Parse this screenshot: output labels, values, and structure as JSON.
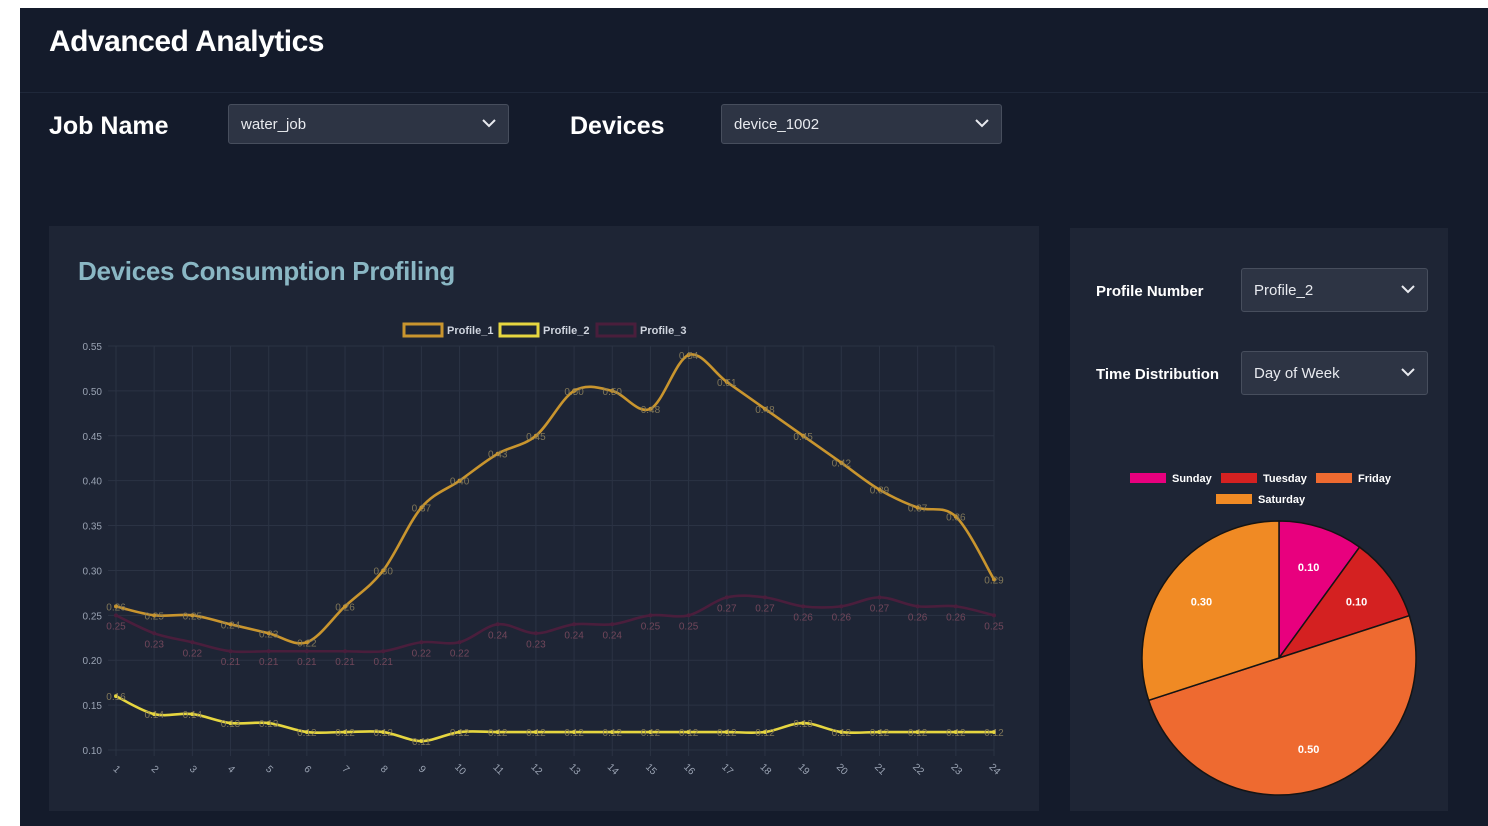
{
  "header": {
    "title": "Advanced Analytics"
  },
  "filters": {
    "job_name_label": "Job Name",
    "job_name_value": "water_job",
    "devices_label": "Devices",
    "devices_value": "device_1002"
  },
  "profiling_panel": {
    "title": "Devices Consumption Profiling"
  },
  "side_panel": {
    "profile_number_label": "Profile Number",
    "profile_number_value": "Profile_2",
    "time_distribution_label": "Time Distribution",
    "time_distribution_value": "Day of Week"
  },
  "colors": {
    "app_bg": "#141b2b",
    "panel_bg": "#1e2535",
    "profile_1": "#c9952e",
    "profile_2": "#e6d640",
    "profile_3": "#4a1e3c",
    "sunday": "#e8007e",
    "tuesday": "#d42121",
    "friday": "#ee6a30",
    "saturday": "#f08a24"
  },
  "chart_data": [
    {
      "type": "line",
      "x": [
        "1",
        "2",
        "3",
        "4",
        "5",
        "6",
        "7",
        "8",
        "9",
        "10",
        "11",
        "12",
        "13",
        "14",
        "15",
        "16",
        "17",
        "18",
        "19",
        "20",
        "21",
        "22",
        "23",
        "24"
      ],
      "series": [
        {
          "name": "Profile_1",
          "color": "#c9952e",
          "values": [
            0.26,
            0.25,
            0.25,
            0.24,
            0.23,
            0.22,
            0.26,
            0.3,
            0.37,
            0.4,
            0.43,
            0.45,
            0.5,
            0.5,
            0.48,
            0.54,
            0.51,
            0.48,
            0.45,
            0.42,
            0.39,
            0.37,
            0.36,
            0.29
          ]
        },
        {
          "name": "Profile_2",
          "color": "#e6d640",
          "values": [
            0.16,
            0.14,
            0.14,
            0.13,
            0.13,
            0.12,
            0.12,
            0.12,
            0.11,
            0.12,
            0.12,
            0.12,
            0.12,
            0.12,
            0.12,
            0.12,
            0.12,
            0.12,
            0.13,
            0.12,
            0.12,
            0.12,
            0.12,
            0.12
          ]
        },
        {
          "name": "Profile_3",
          "color": "#4a1e3c",
          "values": [
            0.25,
            0.23,
            0.22,
            0.21,
            0.21,
            0.21,
            0.21,
            0.21,
            0.22,
            0.22,
            0.24,
            0.23,
            0.24,
            0.24,
            0.25,
            0.25,
            0.27,
            0.27,
            0.26,
            0.26,
            0.27,
            0.26,
            0.26,
            0.25
          ]
        }
      ],
      "yticks": [
        "0.10",
        "0.15",
        "0.20",
        "0.25",
        "0.30",
        "0.35",
        "0.40",
        "0.45",
        "0.50",
        "0.55"
      ],
      "ylim": [
        0.1,
        0.55
      ],
      "legend": "top-center",
      "grid": true
    },
    {
      "type": "pie",
      "labels": [
        "Sunday",
        "Tuesday",
        "Friday",
        "Saturday"
      ],
      "values": [
        0.1,
        0.1,
        0.5,
        0.3
      ],
      "value_labels": [
        "0.10",
        "0.10",
        "0.50",
        "0.30"
      ],
      "colors": [
        "#e8007e",
        "#d42121",
        "#ee6a30",
        "#f08a24"
      ],
      "legend": "top-center"
    }
  ]
}
